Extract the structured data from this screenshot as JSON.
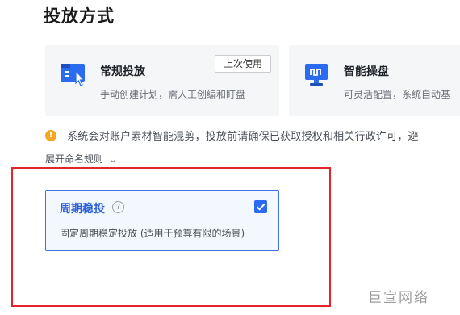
{
  "section_title": "投放方式",
  "modes": [
    {
      "name": "常规投放",
      "desc": "手动创建计划，需人工创编和盯盘",
      "badge": "上次使用",
      "icon": "manual-cursor-icon"
    },
    {
      "name": "智能操盘",
      "desc": "可灵活配置，系统自动基",
      "icon": "smart-monitor-icon"
    }
  ],
  "notice": {
    "icon": "warning-icon",
    "text": "系统会对账户素材智能混剪，投放前请确保已获取授权和相关行政许可，避"
  },
  "rule_toggle": {
    "label": "展开命名规则",
    "icon": "double-chevron-down-icon"
  },
  "period_option": {
    "title": "周期稳投",
    "desc": "固定周期稳定投放 (适用于预算有限的场景)",
    "checked": true
  },
  "watermark": "巨宣网络",
  "colors": {
    "accent": "#2b6bf0",
    "highlight_frame": "#e5232b",
    "warning": "#f5a623"
  }
}
